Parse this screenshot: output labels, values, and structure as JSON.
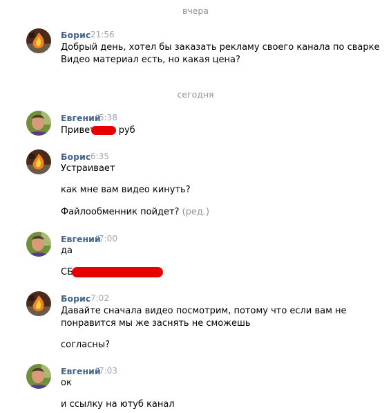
{
  "separators": {
    "yesterday": "вчера",
    "today": "сегодня"
  },
  "messages": [
    {
      "author": "Борис",
      "time": "21:56",
      "lines": [
        "Добрый день, хотел бы заказать рекламу своего канала по сварке",
        "Видео материал есть, но какая цена?"
      ]
    },
    {
      "author": "Евгений",
      "time": "5:38",
      "lines": [
        "Привет",
        "руб"
      ]
    },
    {
      "author": "Борис",
      "time": "6:35",
      "lines": [
        "Устраивает",
        "как мне вам видео кинуть?",
        "Файлообменник пойдет?"
      ],
      "edited": "(ред.)"
    },
    {
      "author": "Евгений",
      "time": "7:00",
      "lines": [
        "да",
        "СБ"
      ]
    },
    {
      "author": "Борис",
      "time": "7:02",
      "lines": [
        "Давайте сначала видео посмотрим, потому что если вам не",
        "понравится мы же заснять не сможешь",
        "согласны?"
      ]
    },
    {
      "author": "Евгений",
      "time": "7:03",
      "lines": [
        "ок",
        "и ссылку на ютуб канал"
      ]
    }
  ],
  "colors": {
    "author": "#42648b",
    "time": "#a0a7b0",
    "separator": "#939393",
    "redaction": "#e60000"
  },
  "icons": {
    "boris_avatar": "fire-avatar-icon",
    "evgeny_avatar": "person-avatar-icon"
  }
}
